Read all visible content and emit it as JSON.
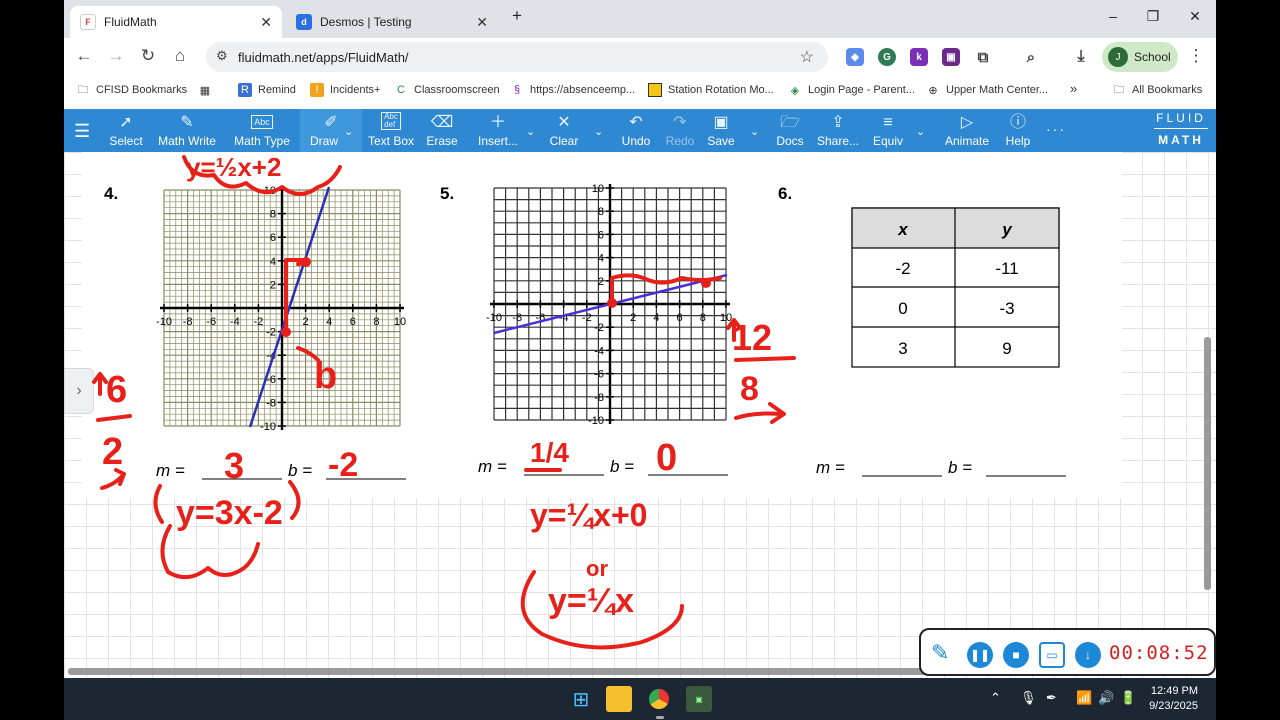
{
  "browser": {
    "tabs": [
      {
        "title": "FluidMath",
        "icon": "fluidmath-favicon",
        "active": true
      },
      {
        "title": "Desmos | Testing",
        "icon": "desmos-favicon",
        "active": false
      }
    ],
    "new_tab": "+",
    "window_controls": {
      "minimize": "–",
      "restore": "❐",
      "close": "✕"
    },
    "url": "fluidmath.net/apps/FluidMath/",
    "profile_initial": "J",
    "profile_label": "School"
  },
  "bookmarks": [
    {
      "label": "CFISD Bookmarks",
      "icon": "folder-icon"
    },
    {
      "label": "",
      "icon": "apps-grid-icon"
    },
    {
      "label": "Remind",
      "icon": "remind-icon"
    },
    {
      "label": "Incidents+",
      "icon": "incidents-icon"
    },
    {
      "label": "Classroomscreen",
      "icon": "classroomscreen-icon"
    },
    {
      "label": "https://absenceemp...",
      "icon": "absence-icon"
    },
    {
      "label": "Station Rotation Mo...",
      "icon": "station-icon"
    },
    {
      "label": "Login Page - Parent...",
      "icon": "login-icon"
    },
    {
      "label": "Upper Math Center...",
      "icon": "globe-icon"
    }
  ],
  "all_bookmarks": "All Bookmarks",
  "fluidmath_toolbar": {
    "tools": [
      {
        "label": "Select",
        "icon": "cursor-icon"
      },
      {
        "label": "Math Write",
        "icon": "pencil-icon"
      },
      {
        "label": "Math Type",
        "icon": "abc-box-icon",
        "icon_text": "Abc"
      },
      {
        "label": "Draw",
        "icon": "pen-icon"
      },
      {
        "label": "Text Box",
        "icon": "text-box-icon",
        "icon_text": "Abc\ndef"
      },
      {
        "label": "Erase",
        "icon": "eraser-icon"
      },
      {
        "label": "Insert...",
        "icon": "plus-icon"
      },
      {
        "label": "Clear",
        "icon": "x-icon"
      },
      {
        "label": "Undo",
        "icon": "undo-icon"
      },
      {
        "label": "Redo",
        "icon": "redo-icon"
      },
      {
        "label": "Save",
        "icon": "save-icon"
      },
      {
        "label": "Docs",
        "icon": "folder-open-icon"
      },
      {
        "label": "Share...",
        "icon": "share-icon"
      },
      {
        "label": "Equiv",
        "icon": "equiv-icon"
      },
      {
        "label": "Animate",
        "icon": "play-icon"
      },
      {
        "label": "Help",
        "icon": "help-icon"
      }
    ],
    "brand_top": "FLUID",
    "brand_bottom": "MATH"
  },
  "worksheet": {
    "problems": [
      {
        "number": "4.",
        "m_label": "m =",
        "b_label": "b =",
        "m_answer": "3",
        "b_answer": "-2"
      },
      {
        "number": "5.",
        "m_label": "m =",
        "b_label": "b =",
        "m_answer": "1/4",
        "b_answer": "0"
      },
      {
        "number": "6.",
        "m_label": "m =",
        "b_label": "b =",
        "m_answer": "",
        "b_answer": ""
      }
    ],
    "axis_ticks": [
      "-10",
      "-8",
      "-6",
      "-4",
      "-2",
      "2",
      "4",
      "6",
      "8",
      "10"
    ],
    "axis_ticks_y": [
      "10",
      "8",
      "6",
      "4",
      "2",
      "-2",
      "-4",
      "-6",
      "-8",
      "-10"
    ],
    "table": {
      "headers": [
        "x",
        "y"
      ],
      "rows": [
        [
          "-2",
          "-11"
        ],
        [
          "0",
          "-3"
        ],
        [
          "3",
          "9"
        ]
      ]
    },
    "annotations": {
      "p4_rise": "6",
      "p4_run": "2",
      "p4_b_label": "b",
      "p4_equation": "y=3x-2",
      "p4_top_fragment": "y=½x+2",
      "p5_rise_run": [
        "12",
        "8"
      ],
      "p5_equation": "y=¼x+0",
      "p5_or": "or",
      "p5_equation_alt": "y=¼x"
    }
  },
  "recorder": {
    "time": "00:08:52"
  },
  "taskbar": {
    "time": "12:49 PM",
    "date": "9/23/2025"
  },
  "colors": {
    "fluidmath_blue": "#2f89d2",
    "ink_red": "#e8201a",
    "line_blue": "#2b2fb8",
    "grid_olive": "#8a8a60"
  }
}
